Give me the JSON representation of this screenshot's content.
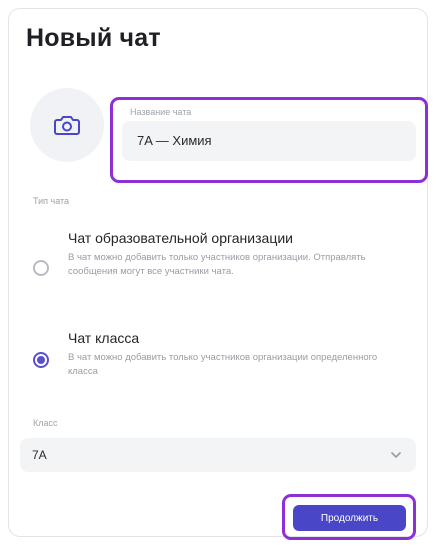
{
  "dialog": {
    "title": "Новый чат"
  },
  "chat_name": {
    "label": "Название чата",
    "value": "7A — Химия"
  },
  "chat_type": {
    "label": "Тип чата",
    "options": [
      {
        "title": "Чат образовательной организации",
        "description": "В чат можно добавить только участников организации. Отправлять сообщения могут все участники чата.",
        "selected": false
      },
      {
        "title": "Чат класса",
        "description": "В чат можно добавить только участников организации определенного класса",
        "selected": true
      }
    ]
  },
  "class_field": {
    "label": "Класс",
    "value": "7A"
  },
  "actions": {
    "continue_label": "Продолжить"
  },
  "icons": {
    "avatar": "camera-icon",
    "select": "chevron-down-icon"
  },
  "colors": {
    "accent": "#4a46c8",
    "highlight": "#8c2fd6",
    "radio_selected": "#5a4fcf"
  }
}
